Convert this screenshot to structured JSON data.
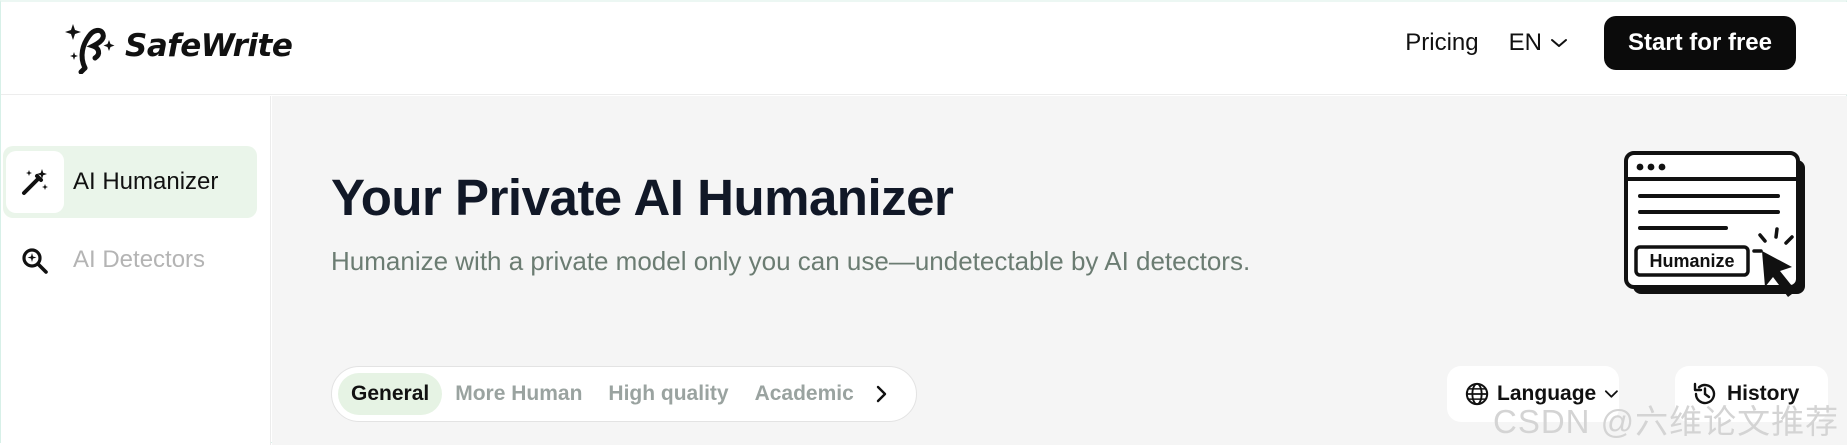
{
  "header": {
    "brand": "SafeWrite",
    "nav_pricing": "Pricing",
    "language_code": "EN",
    "cta_label": "Start for free"
  },
  "sidebar": {
    "items": [
      {
        "label": "AI Humanizer",
        "icon": "magic-wand-icon",
        "active": true
      },
      {
        "label": "AI Detectors",
        "icon": "search-sparkle-icon",
        "active": false
      }
    ]
  },
  "main": {
    "title": "Your Private AI Humanizer",
    "subtitle": "Humanize with a private model only you can use—undetectable by AI detectors.",
    "illustration_button": "Humanize",
    "modes": [
      {
        "label": "General",
        "active": true
      },
      {
        "label": "More Human",
        "active": false
      },
      {
        "label": "High quality",
        "active": false
      },
      {
        "label": "Academic",
        "active": false
      }
    ],
    "language_button": "Language",
    "history_button": "History"
  },
  "watermark": "CSDN @六维论文推荐",
  "colors": {
    "accent_green_bg": "#eaf5ea",
    "cta_bg": "#0b0b0b",
    "main_bg": "#f5f5f5",
    "subtitle": "#6b7c72"
  }
}
